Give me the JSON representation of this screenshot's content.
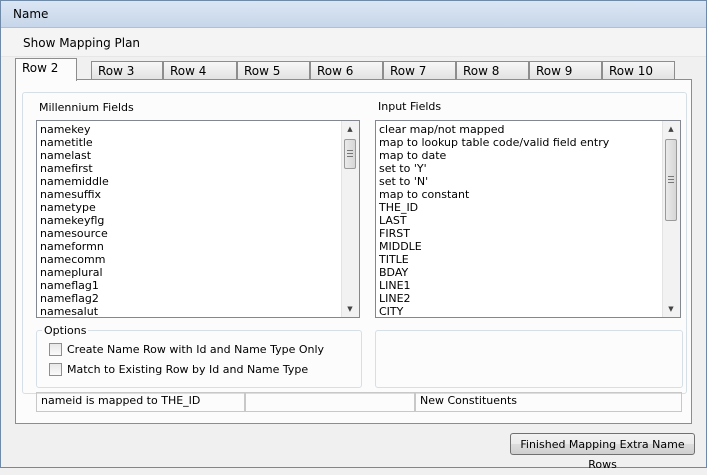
{
  "window": {
    "title": "Name"
  },
  "menu": {
    "show_mapping_plan": "Show Mapping Plan"
  },
  "tabs": [
    "Row 2",
    "Row 3",
    "Row 4",
    "Row 5",
    "Row 6",
    "Row 7",
    "Row 8",
    "Row 9",
    "Row 10"
  ],
  "active_tab": "Row 2",
  "millennium": {
    "label": "Millennium Fields",
    "items": [
      "namekey",
      "nametitle",
      "namelast",
      "namefirst",
      "namemiddle",
      "namesuffix",
      "nametype",
      "namekeyflg",
      "namesource",
      "nameformn",
      "namecomm",
      "nameplural",
      "nameflag1",
      "nameflag2",
      "namesalut"
    ]
  },
  "input": {
    "label": "Input Fields",
    "items": [
      "clear map/not mapped",
      "map to lookup table code/valid field entry",
      "map to date",
      "set to 'Y'",
      "set to 'N'",
      "map to constant",
      "THE_ID",
      "LAST",
      "FIRST",
      "MIDDLE",
      "TITLE",
      "BDAY",
      "LINE1",
      "LINE2",
      "CITY"
    ]
  },
  "options": {
    "label": "Options",
    "create_name_row": "Create Name Row with Id and Name Type Only",
    "match_existing": "Match to Existing Row by Id and Name Type"
  },
  "status": {
    "mapping": "nameid is mapped to THE_ID",
    "middle": "",
    "constituents": "New Constituents"
  },
  "buttons": {
    "finish": "Finished Mapping Extra Name Rows"
  }
}
